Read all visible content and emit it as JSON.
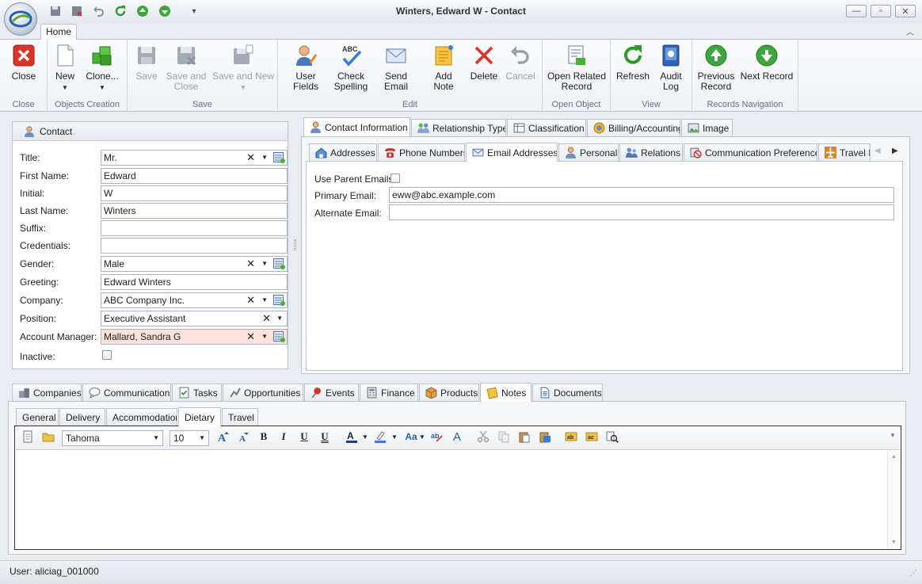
{
  "window": {
    "title": "Winters, Edward W - Contact"
  },
  "ribbon": {
    "tab_home": "Home",
    "groups": {
      "close": "Close",
      "objects_creation": "Objects Creation",
      "save": "Save",
      "edit": "Edit",
      "open_object": "Open Object",
      "view": "View",
      "records_navigation": "Records Navigation"
    },
    "buttons": {
      "close": "Close",
      "new": "New",
      "clone": "Clone...",
      "save": "Save",
      "save_close_1": "Save and",
      "save_close_2": "Close",
      "save_new": "Save and New",
      "user_fields": "User Fields",
      "check_1": "Check",
      "check_2": "Spelling",
      "send_email": "Send Email",
      "add_note": "Add Note",
      "delete": "Delete",
      "cancel": "Cancel",
      "open_related_1": "Open Related",
      "open_related_2": "Record",
      "refresh": "Refresh",
      "audit_1": "Audit",
      "audit_2": "Log",
      "previous_1": "Previous",
      "previous_2": "Record",
      "next_record": "Next Record",
      "abc_text": "ABC"
    }
  },
  "contact": {
    "header": "Contact",
    "fields": {
      "title": {
        "label": "Title:",
        "value": "Mr."
      },
      "first_name": {
        "label": "First Name:",
        "value": "Edward"
      },
      "initial": {
        "label": "Initial:",
        "value": "W"
      },
      "last_name": {
        "label": "Last Name:",
        "value": "Winters"
      },
      "suffix": {
        "label": "Suffix:",
        "value": ""
      },
      "credentials": {
        "label": "Credentials:",
        "value": ""
      },
      "gender": {
        "label": "Gender:",
        "value": "Male"
      },
      "greeting": {
        "label": "Greeting:",
        "value": "Edward Winters"
      },
      "company": {
        "label": "Company:",
        "value": "ABC Company Inc."
      },
      "position": {
        "label": "Position:",
        "value": "Executive Assistant"
      },
      "account_manager": {
        "label": "Account Manager:",
        "value": "Mallard, Sandra G"
      },
      "inactive": {
        "label": "Inactive:"
      }
    }
  },
  "info_tabs": [
    "Contact Information",
    "Relationship Type",
    "Classification",
    "Billing/Accounting",
    "Image"
  ],
  "sub_tabs": [
    "Addresses",
    "Phone Numbers",
    "Email Addresses",
    "Personal",
    "Relations",
    "Communication Preferences",
    "Travel In"
  ],
  "email": {
    "use_parent_label": "Use Parent Emails:",
    "primary_label": "Primary Email:",
    "primary_value": "eww@abc.example.com",
    "alternate_label": "Alternate Email:",
    "alternate_value": ""
  },
  "bottom_tabs": [
    "Companies",
    "Communications",
    "Tasks",
    "Opportunities",
    "Events",
    "Finance",
    "Products",
    "Notes",
    "Documents"
  ],
  "note_tabs": [
    "General",
    "Delivery",
    "Accommodation",
    "Dietary",
    "Travel"
  ],
  "editor": {
    "font": "Tahoma",
    "size": "10"
  },
  "status": {
    "user": "User: aliciag_001000"
  },
  "colors": {
    "accent": "#2b5fa8",
    "highlight": "#fbe3dc",
    "ribbon_bg": "#f4f6f9"
  }
}
